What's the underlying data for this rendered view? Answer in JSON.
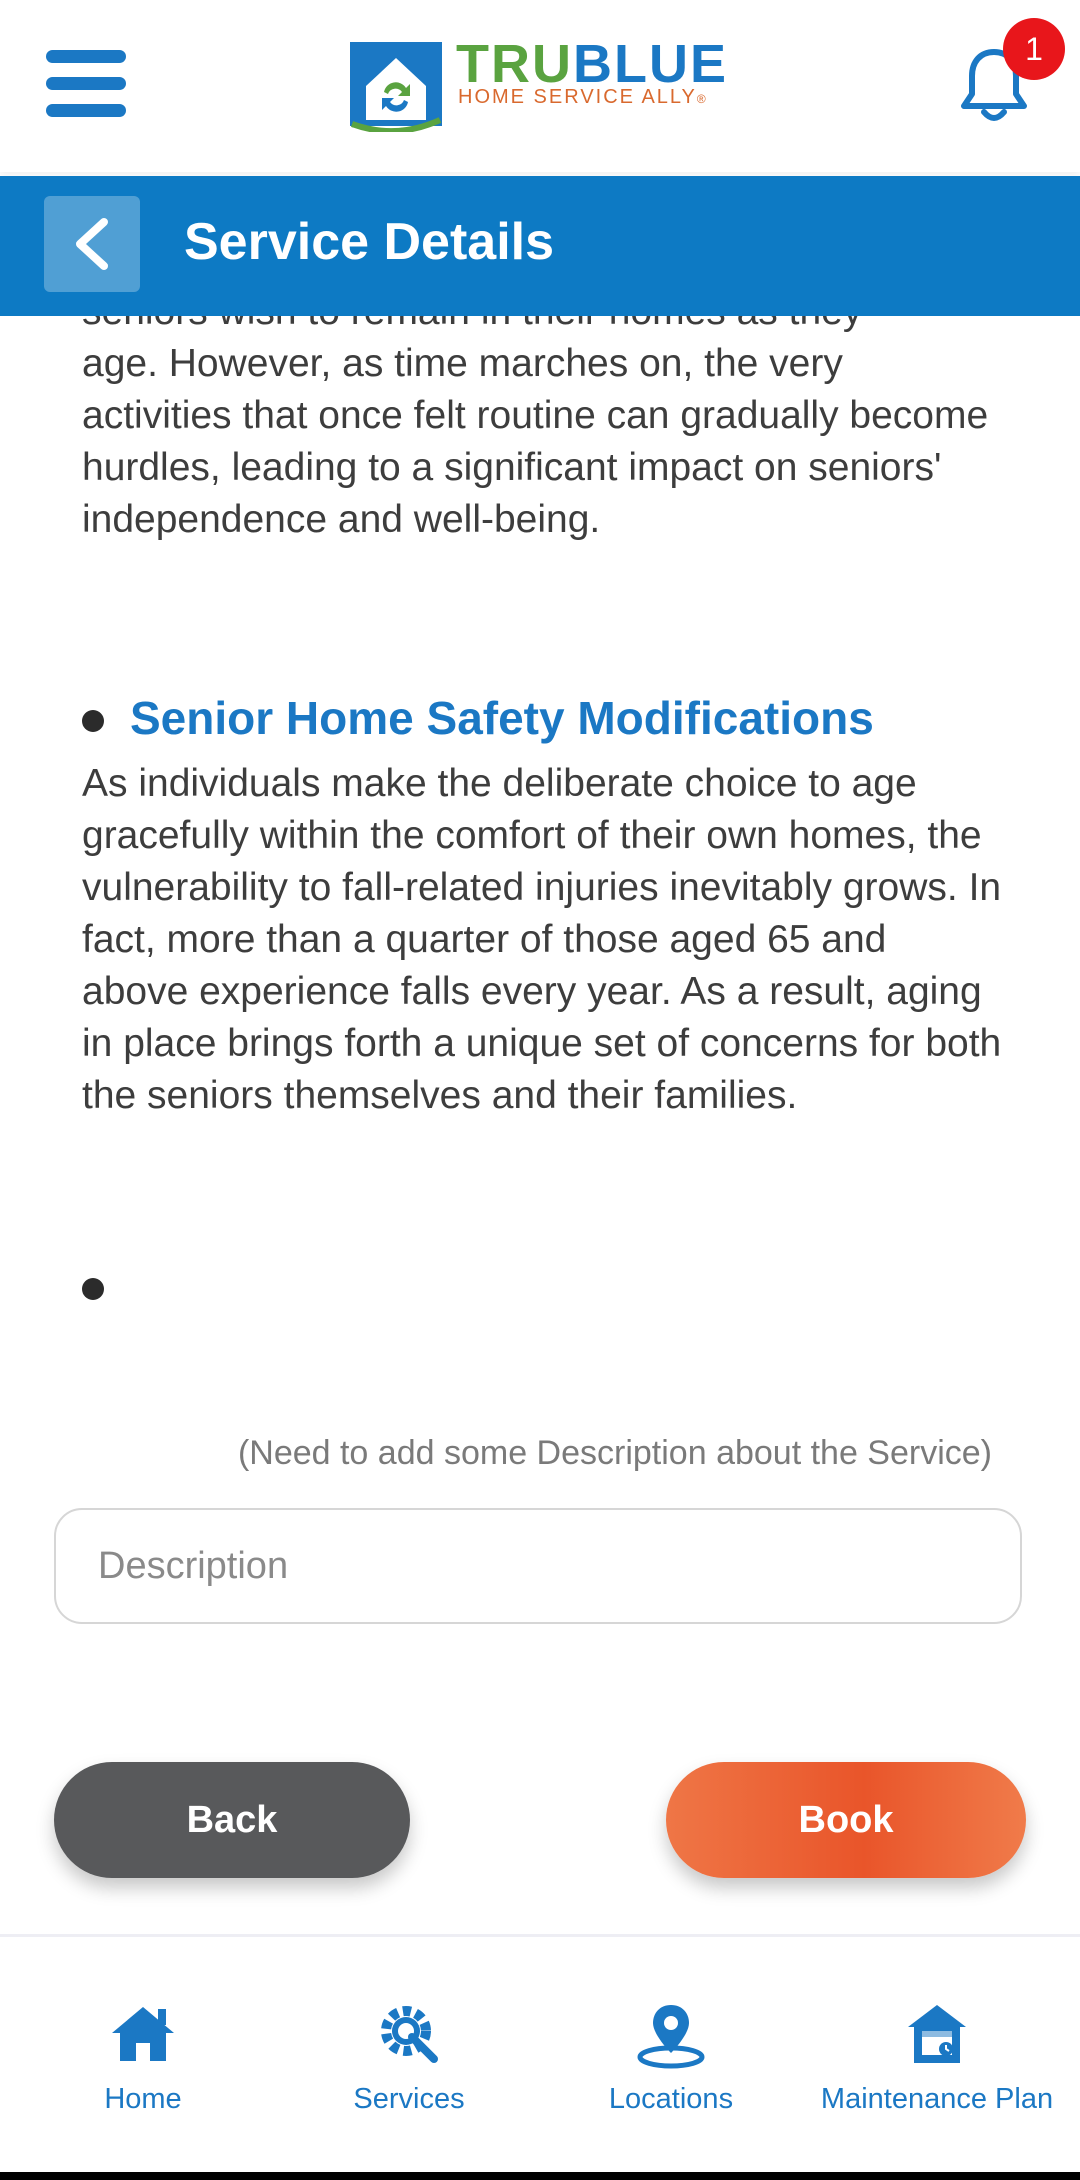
{
  "header": {
    "logo": {
      "brand_part1": "TRU",
      "brand_part2": "BLUE",
      "tagline": "HOME SERVICE ALLY",
      "tagline_mark": "®"
    },
    "notification_count": "1"
  },
  "titlebar": {
    "title": "Service Details"
  },
  "content": {
    "intro_partial_line": "seniors wish to remain in their homes as they",
    "intro_rest": "age. However, as time marches on, the very activities that once felt routine can gradually become hurdles, leading to a significant impact on seniors' independence and well-being.",
    "section_title": "Senior Home Safety Modifications",
    "section_body": "As individuals make the deliberate choice to age gracefully within the comfort of their own homes, the vulnerability to fall-related injuries inevitably grows. In fact, more than a quarter of those aged 65 and above experience falls every year. As a result, aging in place brings forth a unique set of concerns for both the seniors themselves and their families.",
    "note": "(Need to add some Description about the Service)",
    "description_placeholder": "Description",
    "description_value": ""
  },
  "actions": {
    "back_label": "Back",
    "book_label": "Book"
  },
  "bottom_nav": {
    "items": [
      {
        "label": "Home",
        "icon": "home-icon"
      },
      {
        "label": "Services",
        "icon": "services-gear-icon"
      },
      {
        "label": "Locations",
        "icon": "location-pin-icon"
      },
      {
        "label": "Maintenance Plan",
        "icon": "maintenance-plan-icon"
      }
    ]
  },
  "colors": {
    "brand_blue": "#1b78c4",
    "titlebar_blue": "#0d7ac4",
    "brand_green": "#5aa340",
    "accent_orange": "#e9552a",
    "back_gray": "#58595b",
    "badge_red": "#e8161b"
  }
}
